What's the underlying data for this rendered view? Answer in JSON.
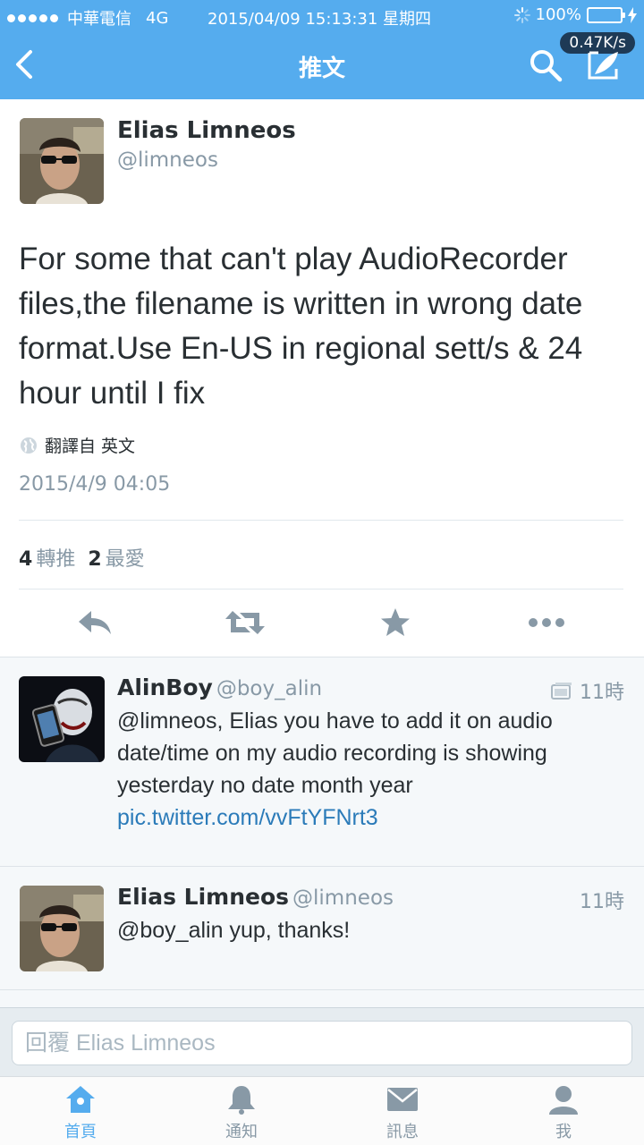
{
  "status_bar": {
    "carrier": "中華電信",
    "network": "4G",
    "datetime": "2015/04/09 15:13:31 星期四",
    "battery": "100%",
    "speed": "0.47K/s"
  },
  "nav": {
    "title": "推文"
  },
  "tweet": {
    "author_name": "Elias Limneos",
    "author_handle": "@limneos",
    "text": "For some that can't play AudioRecorder files,the filename is written in wrong date format.Use En-US in regional sett/s & 24 hour until I fix",
    "translate_label": "翻譯自 英文",
    "date": "2015/4/9 04:05",
    "retweet_count": "4",
    "retweet_label": "轉推",
    "favorite_count": "2",
    "favorite_label": "最愛"
  },
  "replies": [
    {
      "name": "AlinBoy",
      "handle": "@boy_alin",
      "time": "11時",
      "text": "@limneos, Elias you have to add it on audio date/time on my audio recording is showing yesterday no date month year",
      "link": "pic.twitter.com/vvFtYFNrt3"
    },
    {
      "name": "Elias Limneos",
      "handle": "@limneos",
      "time": "11時",
      "text": "@boy_alin yup, thanks!"
    }
  ],
  "reply_box": {
    "placeholder": "回覆 Elias Limneos"
  },
  "tabs": [
    {
      "label": "首頁",
      "icon": "home-icon",
      "active": true
    },
    {
      "label": "通知",
      "icon": "bell-icon",
      "active": false
    },
    {
      "label": "訊息",
      "icon": "envelope-icon",
      "active": false
    },
    {
      "label": "我",
      "icon": "user-icon",
      "active": false
    }
  ],
  "colors": {
    "accent": "#55acee",
    "link": "#2b7bb9",
    "muted": "#8899a6",
    "battery": "#4cd964"
  }
}
